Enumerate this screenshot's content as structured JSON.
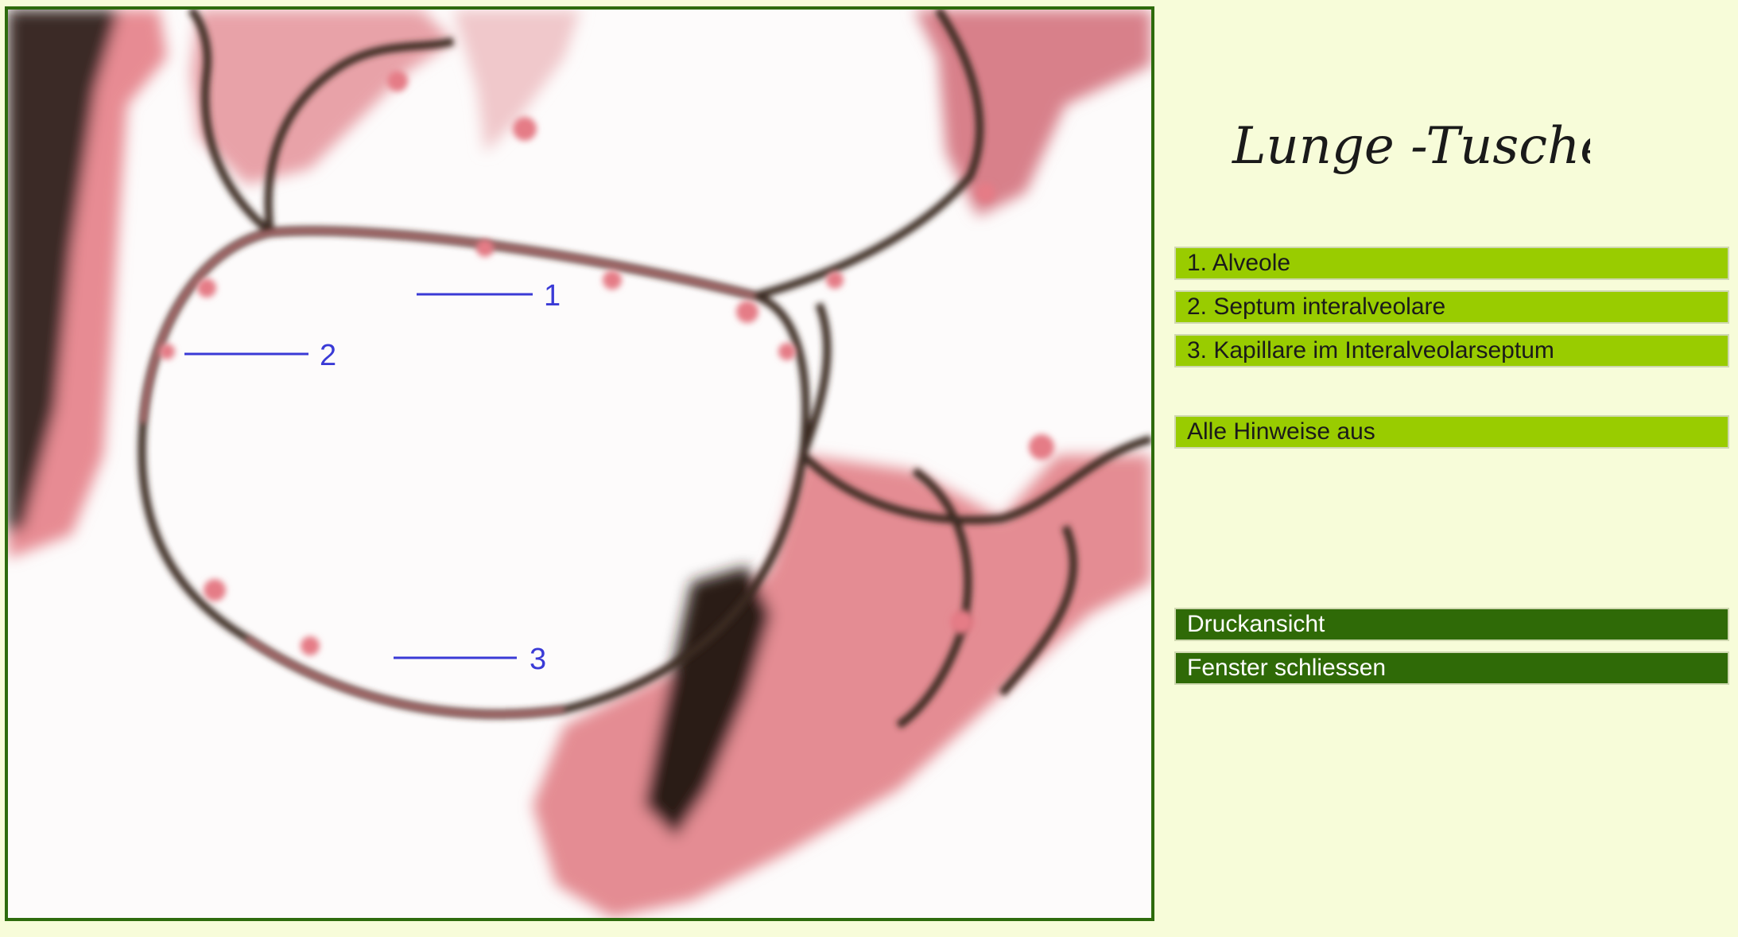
{
  "title": "Lunge -Tusche",
  "labels": [
    {
      "number": "1"
    },
    {
      "number": "2"
    },
    {
      "number": "3"
    }
  ],
  "hints": [
    {
      "label": "1. Alveole"
    },
    {
      "label": "2. Septum interalveolare"
    },
    {
      "label": "3. Kapillare im Interalveolarseptum"
    }
  ],
  "toggle_all_label": "Alle Hinweise aus",
  "actions": {
    "print_label": "Druckansicht",
    "close_label": "Fenster schliessen"
  },
  "colors": {
    "page_background": "#f7fcd9",
    "frame_border": "#2e6b0d",
    "hint_button": "#99cc00",
    "action_button": "#2f6a07",
    "annotation": "#3a3ad6"
  }
}
